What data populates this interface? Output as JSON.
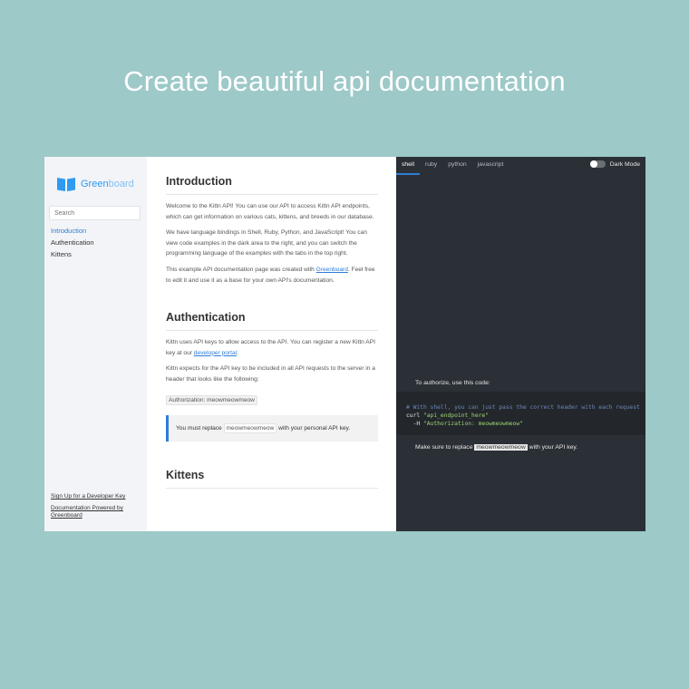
{
  "headline": "Create beautiful api documentation",
  "brand": {
    "name_a": "Green",
    "name_b": "board"
  },
  "search": {
    "placeholder": "Search"
  },
  "nav": {
    "items": [
      "Introduction",
      "Authentication",
      "Kittens"
    ]
  },
  "side_links": [
    "Sign Up for a Developer Key",
    "Documentation Powered by Greenboard"
  ],
  "content": {
    "intro_title": "Introduction",
    "intro_p1": "Welcome to the Kittn API! You can use our API to access Kittn API endpoints, which can get information on various cats, kittens, and breeds in our database.",
    "intro_p2": "We have language bindings in Shell, Ruby, Python, and JavaScript! You can view code examples in the dark area to the right, and you can switch the programming language of the examples with the tabs in the top right.",
    "intro_p3_pre": "This example API documentation page was created with ",
    "intro_p3_link": "Greenboard",
    "intro_p3_post": ". Feel free to edit it and use it as a base for your own API's documentation.",
    "auth_title": "Authentication",
    "auth_p1_pre": "Kittn uses API keys to allow access to the API. You can register a new Kittn API key at our ",
    "auth_p1_link": "developer portal",
    "auth_p1_post": ".",
    "auth_p2": "Kittn expects for the API key to be included in all API requests to the server in a header that looks like the following:",
    "auth_header": "Authorization: meowmeowmeow",
    "notice_pre": "You must replace ",
    "notice_code": "meowmeowmeow",
    "notice_post": " with your personal API key.",
    "kittens_title": "Kittens"
  },
  "dark": {
    "tabs": [
      "shell",
      "ruby",
      "python",
      "javascript"
    ],
    "toggle_label": "Dark Mode",
    "authorize_text": "To authorize, use this code:",
    "code_comment": "# With shell, you can just pass the correct header with each request",
    "code_line2_cmd": "curl ",
    "code_line2_str": "\"api_endpoint_here\"",
    "code_line3_cmd": "  -H ",
    "code_line3_str": "\"Authorization: meowmeowmeow\"",
    "replace_pre": "Make sure to replace ",
    "replace_code": "meowmeowmeow",
    "replace_post": " with your API key."
  },
  "colors": {
    "background": "#9dc9c8",
    "accent": "#2f7dd6",
    "dark_pane": "#2b3036"
  }
}
